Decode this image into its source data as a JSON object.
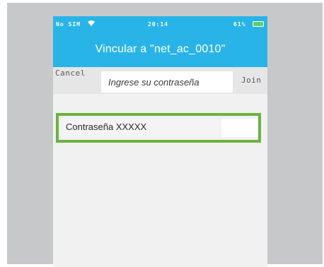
{
  "status_bar": {
    "carrier": "No SIM",
    "wifi_icon": "wifi-icon",
    "time": "20:14",
    "battery": "61%",
    "battery_icon": "battery-icon"
  },
  "nav": {
    "title": "Vincular a \"net_ac_0010\""
  },
  "toolbar": {
    "cancel_label": "Cancel",
    "prompt": "Ingrese su contraseña",
    "join_label": "Join"
  },
  "password_field": {
    "value": "Contraseña XXXXX"
  },
  "colors": {
    "accent_blue": "#29b4e8",
    "highlight_green": "#6cb33f",
    "frame_gray": "#c7c8ca"
  }
}
